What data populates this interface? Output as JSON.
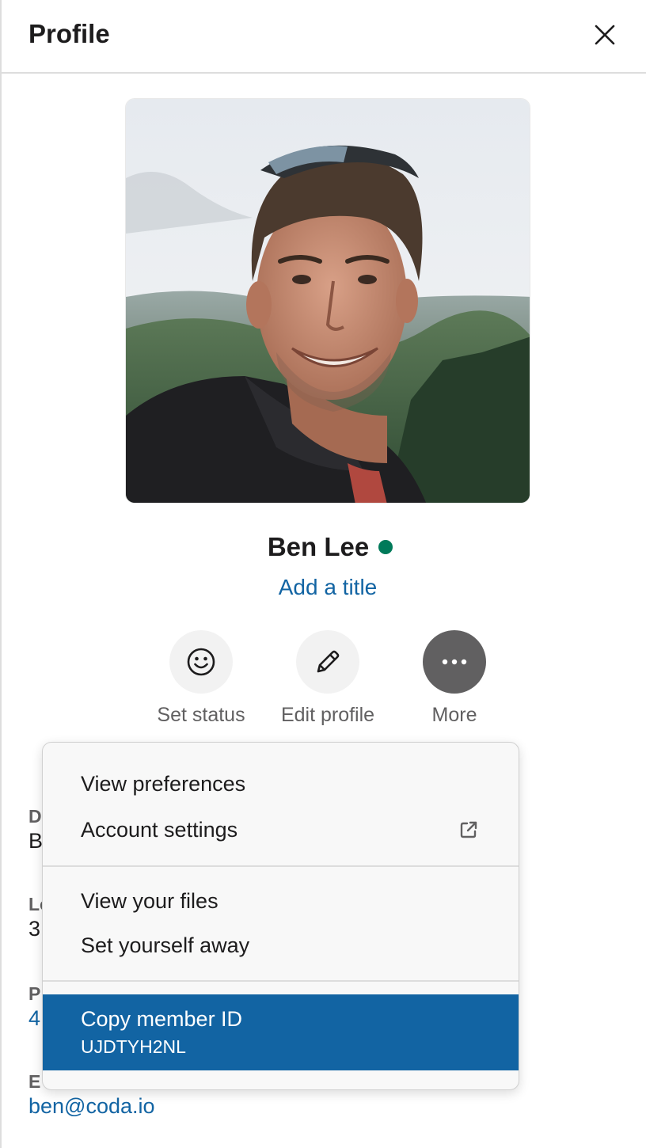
{
  "header": {
    "title": "Profile"
  },
  "profile": {
    "name": "Ben Lee",
    "presence_color": "#007a5a",
    "title_prompt": "Add a title"
  },
  "actions": [
    {
      "label": "Set status",
      "icon": "smiley-icon"
    },
    {
      "label": "Edit profile",
      "icon": "pencil-icon"
    },
    {
      "label": "More",
      "icon": "more-icon"
    }
  ],
  "fields": [
    {
      "label": "D",
      "value": "B"
    },
    {
      "label": "Lo",
      "value": "3"
    },
    {
      "label": "P",
      "value": "4"
    },
    {
      "label": "E",
      "value": "ben@coda.io"
    }
  ],
  "menu": {
    "items": [
      {
        "label": "View preferences"
      },
      {
        "label": "Account settings",
        "icon": "external-link-icon"
      },
      {
        "label": "View your files"
      },
      {
        "label": "Set yourself away"
      }
    ],
    "copy_id": {
      "label": "Copy member ID",
      "value": "UJDTYH2NL"
    }
  },
  "colors": {
    "accent": "#1264a3",
    "link": "#1264a3",
    "text": "#1d1c1d",
    "muted": "#616061"
  }
}
